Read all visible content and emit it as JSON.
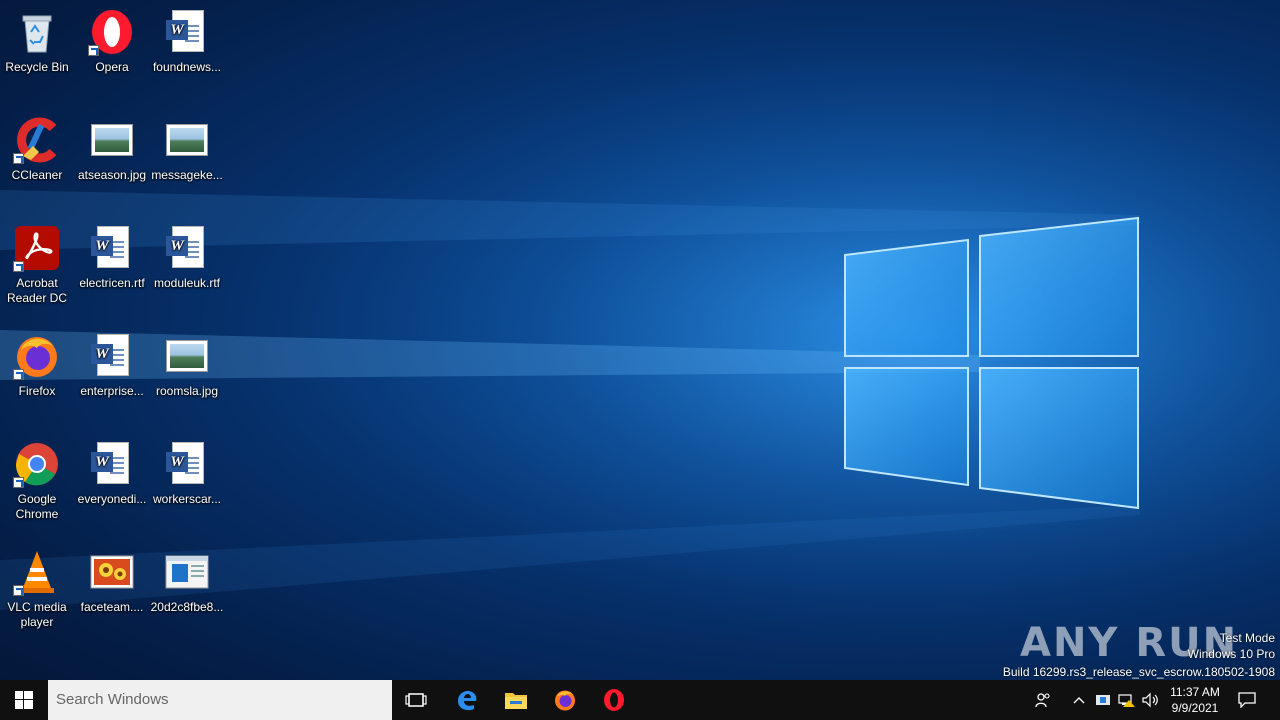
{
  "desktop": {
    "icons": [
      {
        "label": "Recycle Bin",
        "icon": "recycle-bin-icon"
      },
      {
        "label": "Opera",
        "icon": "opera-icon"
      },
      {
        "label": "foundnews...",
        "icon": "word-document-icon"
      },
      {
        "label": "CCleaner",
        "icon": "ccleaner-icon"
      },
      {
        "label": "atseason.jpg",
        "icon": "image-file-icon"
      },
      {
        "label": "messageke...",
        "icon": "image-file-icon"
      },
      {
        "label": "Acrobat Reader DC",
        "icon": "acrobat-icon"
      },
      {
        "label": "electricen.rtf",
        "icon": "word-document-icon"
      },
      {
        "label": "moduleuk.rtf",
        "icon": "word-document-icon"
      },
      {
        "label": "Firefox",
        "icon": "firefox-icon"
      },
      {
        "label": "enterprise...",
        "icon": "word-document-icon"
      },
      {
        "label": "roomsla.jpg",
        "icon": "image-file-icon"
      },
      {
        "label": "Google Chrome",
        "icon": "chrome-icon"
      },
      {
        "label": "everyonedi...",
        "icon": "word-document-icon"
      },
      {
        "label": "workerscar...",
        "icon": "word-document-icon"
      },
      {
        "label": "VLC media player",
        "icon": "vlc-icon"
      },
      {
        "label": "faceteam....",
        "icon": "image-flower-icon"
      },
      {
        "label": "20d2c8fbe8...",
        "icon": "executable-file-icon"
      }
    ]
  },
  "taskbar": {
    "search_placeholder": "Search Windows",
    "pinned": [
      "task-view-icon",
      "edge-icon",
      "file-explorer-icon",
      "firefox-icon",
      "opera-icon"
    ],
    "tray": {
      "time": "11:37 AM",
      "date": "9/9/2021"
    }
  },
  "watermark": {
    "brand": "ANY RUN",
    "line1": "Test Mode",
    "line2": "Windows 10 Pro",
    "line3": "Build 16299.rs3_release_svc_escrow.180502-1908"
  },
  "colors": {
    "taskbar_bg": "#101010",
    "search_bg": "#f0f0f0",
    "accent_blue": "#0b4a93"
  }
}
